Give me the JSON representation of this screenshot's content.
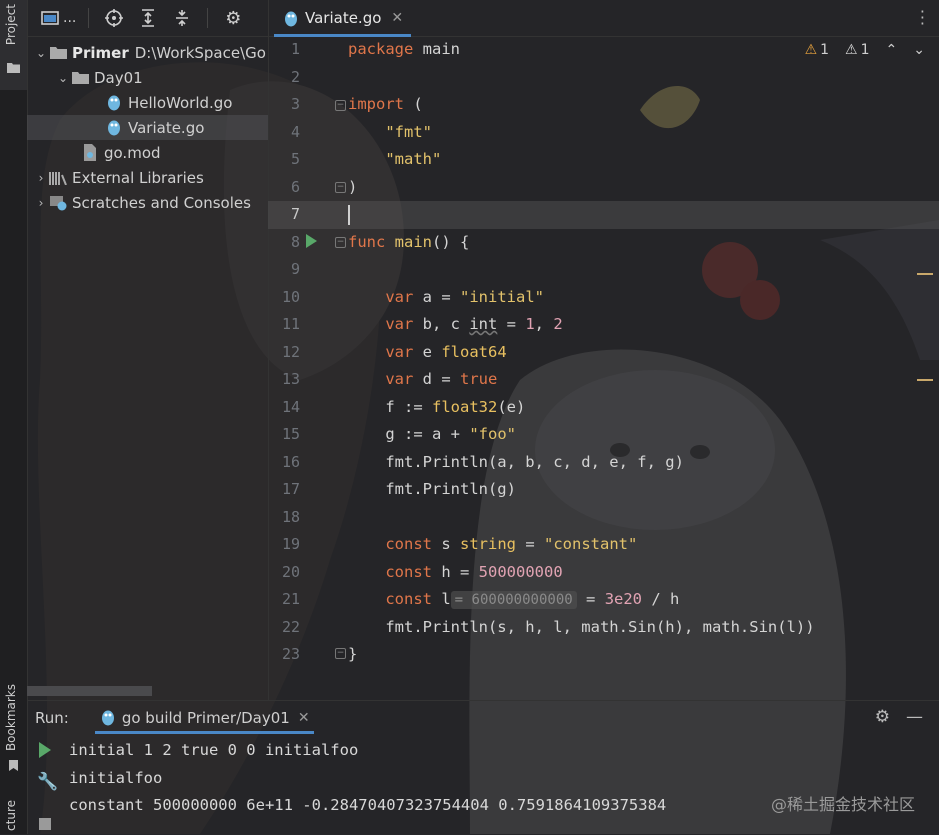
{
  "strip": {
    "project": "Project",
    "bookmarks": "Bookmarks",
    "structure": "cture"
  },
  "project_toolbar": {
    "title_ellipsis": "...",
    "icons": [
      "project-view-icon",
      "locate-icon",
      "expand-all-icon",
      "collapse-all-icon",
      "gear-icon"
    ]
  },
  "tree": {
    "root_name": "Primer",
    "root_path": "D:\\WorkSpace\\Go",
    "day01": "Day01",
    "file1": "HelloWorld.go",
    "file2": "Variate.go",
    "gomod": "go.mod",
    "ext": "External Libraries",
    "scratches": "Scratches and Consoles"
  },
  "tab": {
    "label": "Variate.go",
    "close": "✕"
  },
  "inspections": {
    "warning1": "1",
    "warning2": "1"
  },
  "line_numbers": [
    "1",
    "2",
    "3",
    "4",
    "5",
    "6",
    "7",
    "8",
    "9",
    "10",
    "11",
    "12",
    "13",
    "14",
    "15",
    "16",
    "17",
    "18",
    "19",
    "20",
    "21",
    "22",
    "23"
  ],
  "code": {
    "l1_kw": "package",
    "l1_name": " main",
    "l3_kw": "import",
    "l3_rest": " (",
    "l4": "\"fmt\"",
    "l5": "\"math\"",
    "l6": ")",
    "l8_kw": "func",
    "l8_name": " main",
    "l8_rest": "() {",
    "l10_kw": "var",
    "l10_a": " a = ",
    "l10_s": "\"initial\"",
    "l11_kw": "var",
    "l11_a": " b, c ",
    "l11_t": "int",
    "l11_b": " = ",
    "l11_n1": "1",
    "l11_c": ", ",
    "l11_n2": "2",
    "l12_kw": "var",
    "l12_a": " e ",
    "l12_t": "float64",
    "l13_kw": "var",
    "l13_a": " d = ",
    "l13_b": "true",
    "l14_a": "f := ",
    "l14_f": "float32",
    "l14_b": "(e)",
    "l15_a": "g := a + ",
    "l15_s": "\"foo\"",
    "l16": "fmt.Println(a, b, c, d, e, f, g)",
    "l17": "fmt.Println(g)",
    "l19_kw": "const",
    "l19_a": " s ",
    "l19_t": "string",
    "l19_b": " = ",
    "l19_s": "\"constant\"",
    "l20_kw": "const",
    "l20_a": " h = ",
    "l20_n": "500000000",
    "l21_kw": "const",
    "l21_a": " l",
    "l21_hint": "= 600000000000",
    "l21_b": " = ",
    "l21_n": "3e20",
    "l21_c": " / h",
    "l22": "fmt.Println(s, h, l, math.Sin(h), math.Sin(l))",
    "l23": "}"
  },
  "run": {
    "label": "Run:",
    "tab_label": "go build Primer/Day01",
    "tab_close": "✕",
    "output": [
      "initial 1 2 true 0 0 initialfoo",
      "initialfoo",
      "constant 500000000 6e+11 -0.28470407323754404 0.7591864109375384"
    ]
  },
  "watermark": "@稀土掘金技术社区",
  "colors": {
    "keyword": "#e0764a",
    "string": "#e2c26b",
    "number": "#e1a3b3",
    "accent": "#4a88c7",
    "run_green": "#59a869"
  }
}
